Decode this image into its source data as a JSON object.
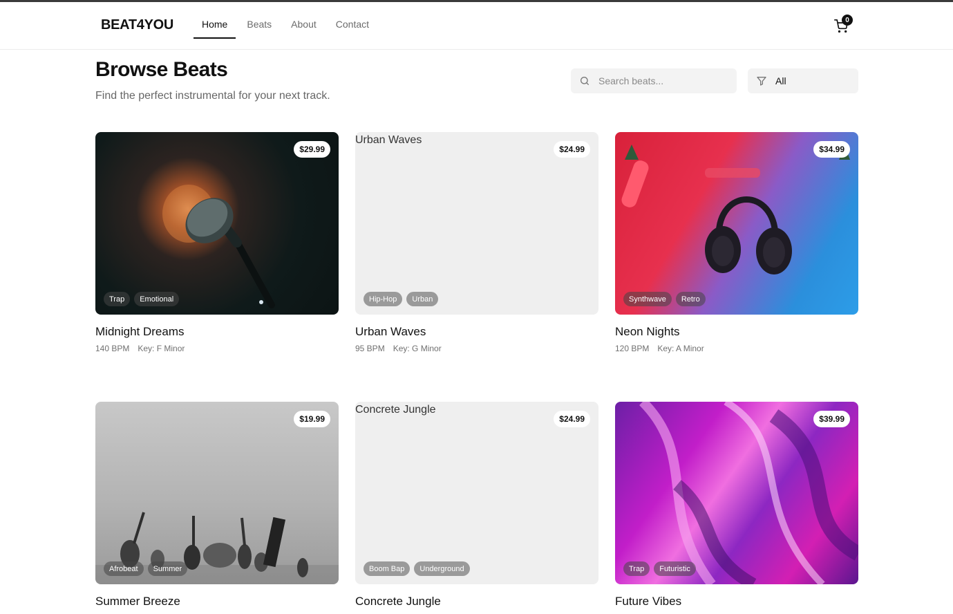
{
  "brand": "BEAT4YOU",
  "nav": [
    {
      "label": "Home",
      "active": true
    },
    {
      "label": "Beats",
      "active": false
    },
    {
      "label": "About",
      "active": false
    },
    {
      "label": "Contact",
      "active": false
    }
  ],
  "cart": {
    "count": "0",
    "icon": "cart-icon"
  },
  "page": {
    "title": "Browse Beats",
    "subtitle": "Find the perfect instrumental for your next track."
  },
  "search": {
    "placeholder": "Search beats...",
    "value": "",
    "icon": "search-icon"
  },
  "filter": {
    "value": "All",
    "icon": "filter-icon"
  },
  "beats": [
    {
      "title": "Midnight Dreams",
      "price": "$29.99",
      "tags": [
        "Trap",
        "Emotional"
      ],
      "bpm": "140 BPM",
      "key": "Key: F Minor",
      "image": "microphone",
      "image_alt": ""
    },
    {
      "title": "Urban Waves",
      "price": "$24.99",
      "tags": [
        "Hip-Hop",
        "Urban"
      ],
      "bpm": "95 BPM",
      "key": "Key: G Minor",
      "image": "broken",
      "image_alt": "Urban Waves"
    },
    {
      "title": "Neon Nights",
      "price": "$34.99",
      "tags": [
        "Synthwave",
        "Retro"
      ],
      "bpm": "120 BPM",
      "key": "Key: A Minor",
      "image": "headphones",
      "image_alt": ""
    },
    {
      "title": "Summer Breeze",
      "price": "$19.99",
      "tags": [
        "Afrobeat",
        "Summer"
      ],
      "bpm": "",
      "key": "",
      "image": "instruments",
      "image_alt": ""
    },
    {
      "title": "Concrete Jungle",
      "price": "$24.99",
      "tags": [
        "Boom Bap",
        "Underground"
      ],
      "bpm": "",
      "key": "",
      "image": "broken",
      "image_alt": "Concrete Jungle"
    },
    {
      "title": "Future Vibes",
      "price": "$39.99",
      "tags": [
        "Trap",
        "Futuristic"
      ],
      "bpm": "",
      "key": "",
      "image": "abstract-purple",
      "image_alt": ""
    }
  ],
  "colors": {
    "accent": "#111111",
    "muted": "#6b6b6b",
    "field_bg": "#f3f3f3"
  }
}
